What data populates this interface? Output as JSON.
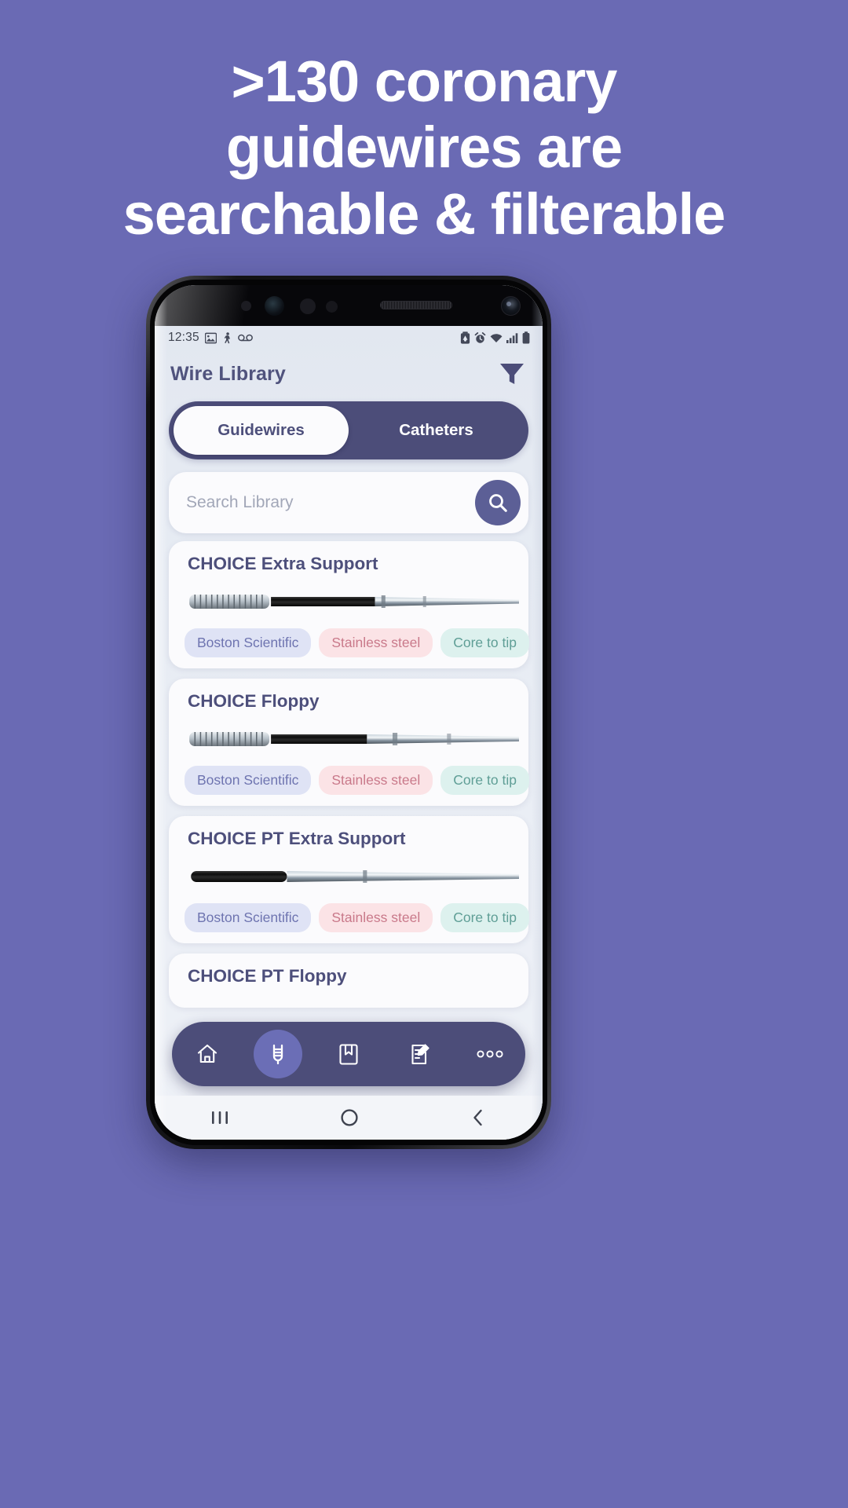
{
  "promo": {
    "headline_lines": [
      "&gt;130 coronary",
      "guidewires are",
      "searchable &amp; filterable"
    ]
  },
  "status_bar": {
    "time": "12:35",
    "left_icons": [
      "image-icon",
      "person-walking-icon",
      "voicemail-icon"
    ],
    "right_icons": [
      "battery-saver-icon",
      "alarm-icon",
      "wifi-icon",
      "signal-icon",
      "battery-icon"
    ]
  },
  "header": {
    "title": "Wire Library",
    "filter_icon": "filter-funnel-icon"
  },
  "tabs": {
    "items": [
      {
        "label": "Guidewires",
        "active": true
      },
      {
        "label": "Catheters",
        "active": false
      }
    ]
  },
  "search": {
    "placeholder": "Search Library",
    "value": "",
    "button_icon": "search-icon"
  },
  "cards": [
    {
      "title": "CHOICE Extra Support",
      "image": "guidewire-coil-tip",
      "chips": [
        {
          "label": "Boston Scientific",
          "kind": "brand"
        },
        {
          "label": "Stainless steel",
          "kind": "mat"
        },
        {
          "label": "Core to tip",
          "kind": "core"
        }
      ]
    },
    {
      "title": "CHOICE Floppy",
      "image": "guidewire-coil-tip",
      "chips": [
        {
          "label": "Boston Scientific",
          "kind": "brand"
        },
        {
          "label": "Stainless steel",
          "kind": "mat"
        },
        {
          "label": "Core to tip",
          "kind": "core"
        }
      ]
    },
    {
      "title": "CHOICE PT Extra Support",
      "image": "guidewire-smooth-tip",
      "chips": [
        {
          "label": "Boston Scientific",
          "kind": "brand"
        },
        {
          "label": "Stainless steel",
          "kind": "mat"
        },
        {
          "label": "Core to tip",
          "kind": "core"
        }
      ]
    },
    {
      "title": "CHOICE PT Floppy",
      "image": "guidewire-smooth-tip",
      "chips": []
    }
  ],
  "bottom_nav": {
    "items": [
      {
        "icon": "home-icon",
        "active": false
      },
      {
        "icon": "wire-icon",
        "active": true
      },
      {
        "icon": "book-icon",
        "active": false
      },
      {
        "icon": "notes-edit-icon",
        "active": false
      },
      {
        "icon": "more-dots-icon",
        "active": false
      }
    ]
  },
  "android_nav": {
    "items": [
      "recent-apps-icon",
      "home-circle-icon",
      "back-icon"
    ]
  },
  "colors": {
    "promo_background": "#6a6ab4",
    "accent_navy": "#4c4d79",
    "accent_purple": "#6b6eb6",
    "app_background": "#e4e9f1",
    "card_background": "#fbfbfd",
    "title_text": "#4d4f7b"
  }
}
